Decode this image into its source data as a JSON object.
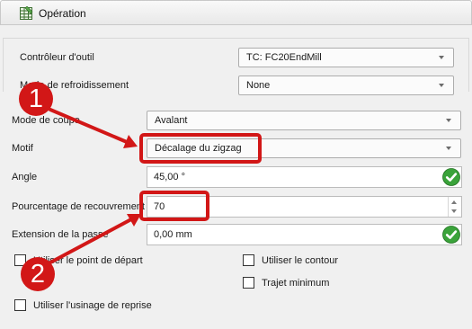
{
  "window": {
    "title": "Opération",
    "icon": "table-icon"
  },
  "form": {
    "tool_controller": {
      "label": "Contrôleur d'outil",
      "value": "TC: FC20EndMill"
    },
    "coolant_mode": {
      "label": "Mode de refroidissement",
      "value": "None"
    },
    "cut_mode": {
      "label": "Mode de coupe",
      "value": "Avalant"
    },
    "pattern": {
      "label": "Motif",
      "value": "Décalage du zigzag"
    },
    "angle": {
      "label": "Angle",
      "value": "45,00 °"
    },
    "step_over": {
      "label": "Pourcentage de recouvrement",
      "value": "70"
    },
    "pass_extension": {
      "label": "Extension de la passe",
      "value": "0,00 mm"
    },
    "use_start_point": {
      "label": "Utiliser le point de départ",
      "checked": false
    },
    "use_outline": {
      "label": "Utiliser le contour",
      "checked": false
    },
    "min_travel": {
      "label": "Trajet minimum",
      "checked": false
    },
    "use_rest_machining": {
      "label": "Utiliser l'usinage de reprise",
      "checked": false
    }
  },
  "annotations": {
    "marker_1": "1",
    "marker_2": "2",
    "color": "#d21717"
  },
  "colors": {
    "valid_check": "#3aa33a"
  }
}
